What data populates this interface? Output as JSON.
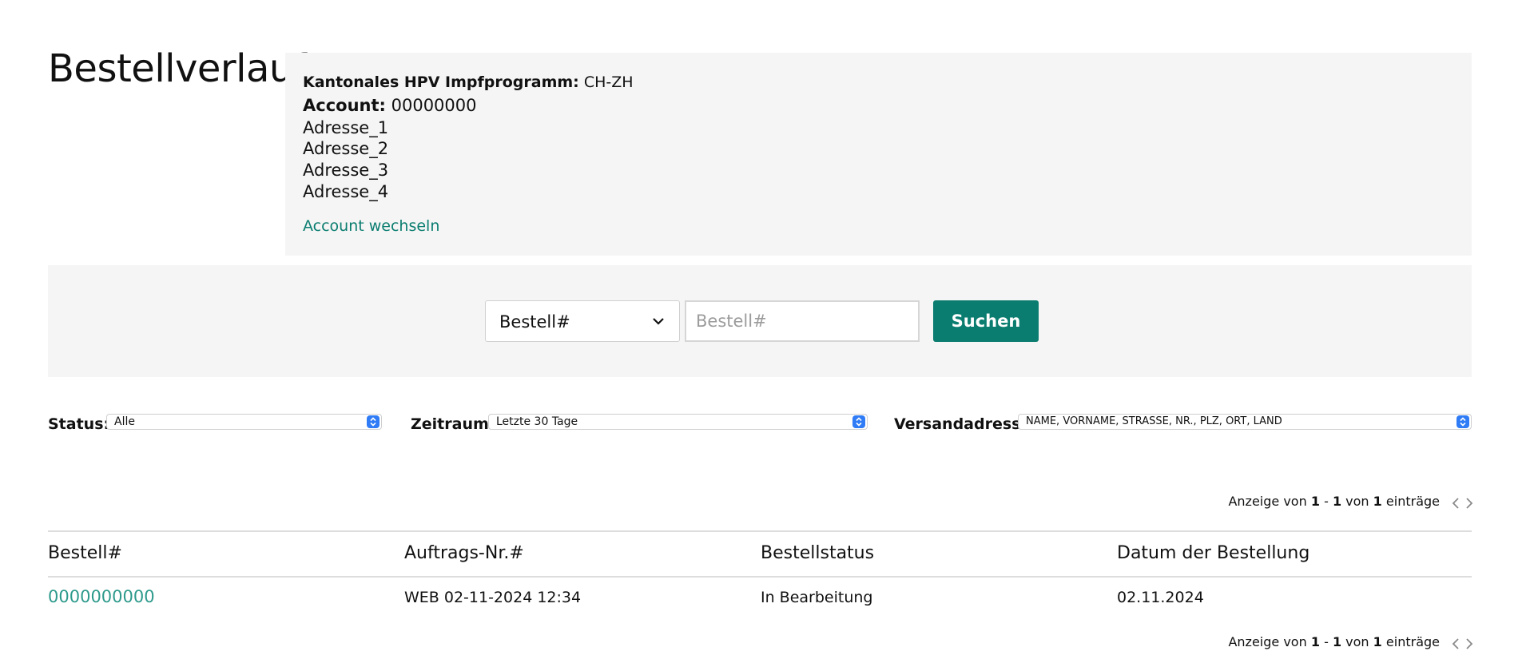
{
  "page": {
    "title": "Bestellverlauf"
  },
  "account": {
    "program_label": "Kantonales HPV Impfprogramm:",
    "program_value": "CH-ZH",
    "account_label": "Account:",
    "account_value": "00000000",
    "addresses": [
      "Adresse_1",
      "Adresse_2",
      "Adresse_3",
      "Adresse_4"
    ],
    "switch_label": "Account wechseln"
  },
  "search": {
    "type_selected": "Bestell#",
    "input_value": "",
    "input_placeholder": "Bestell#",
    "button_label": "Suchen"
  },
  "filters": {
    "status": {
      "label": "Status:",
      "selected": "Alle"
    },
    "period": {
      "label": "Zeitraum:",
      "selected": "Letzte 30 Tage"
    },
    "address": {
      "label": "Versandadresse:",
      "selected": "NAME, VORNAME, STRASSE, NR., PLZ, ORT, LAND"
    }
  },
  "pagination": {
    "prefix": "Anzeige von",
    "from": "1",
    "sep": "-",
    "to": "1",
    "of": "von",
    "total": "1",
    "suffix": "einträge"
  },
  "table": {
    "columns": [
      "Bestell#",
      "Auftrags-Nr.#",
      "Bestellstatus",
      "Datum der Bestellung"
    ],
    "rows": [
      {
        "order_no": "0000000000",
        "job_no": "WEB 02-11-2024 12:34",
        "status": "In Bearbeitung",
        "date": "02.11.2024"
      }
    ]
  },
  "colors": {
    "accent": "#0b7d70",
    "link": "#2e9a8c",
    "panel_bg": "#f5f5f5",
    "stepper": "#2f7cf6"
  }
}
